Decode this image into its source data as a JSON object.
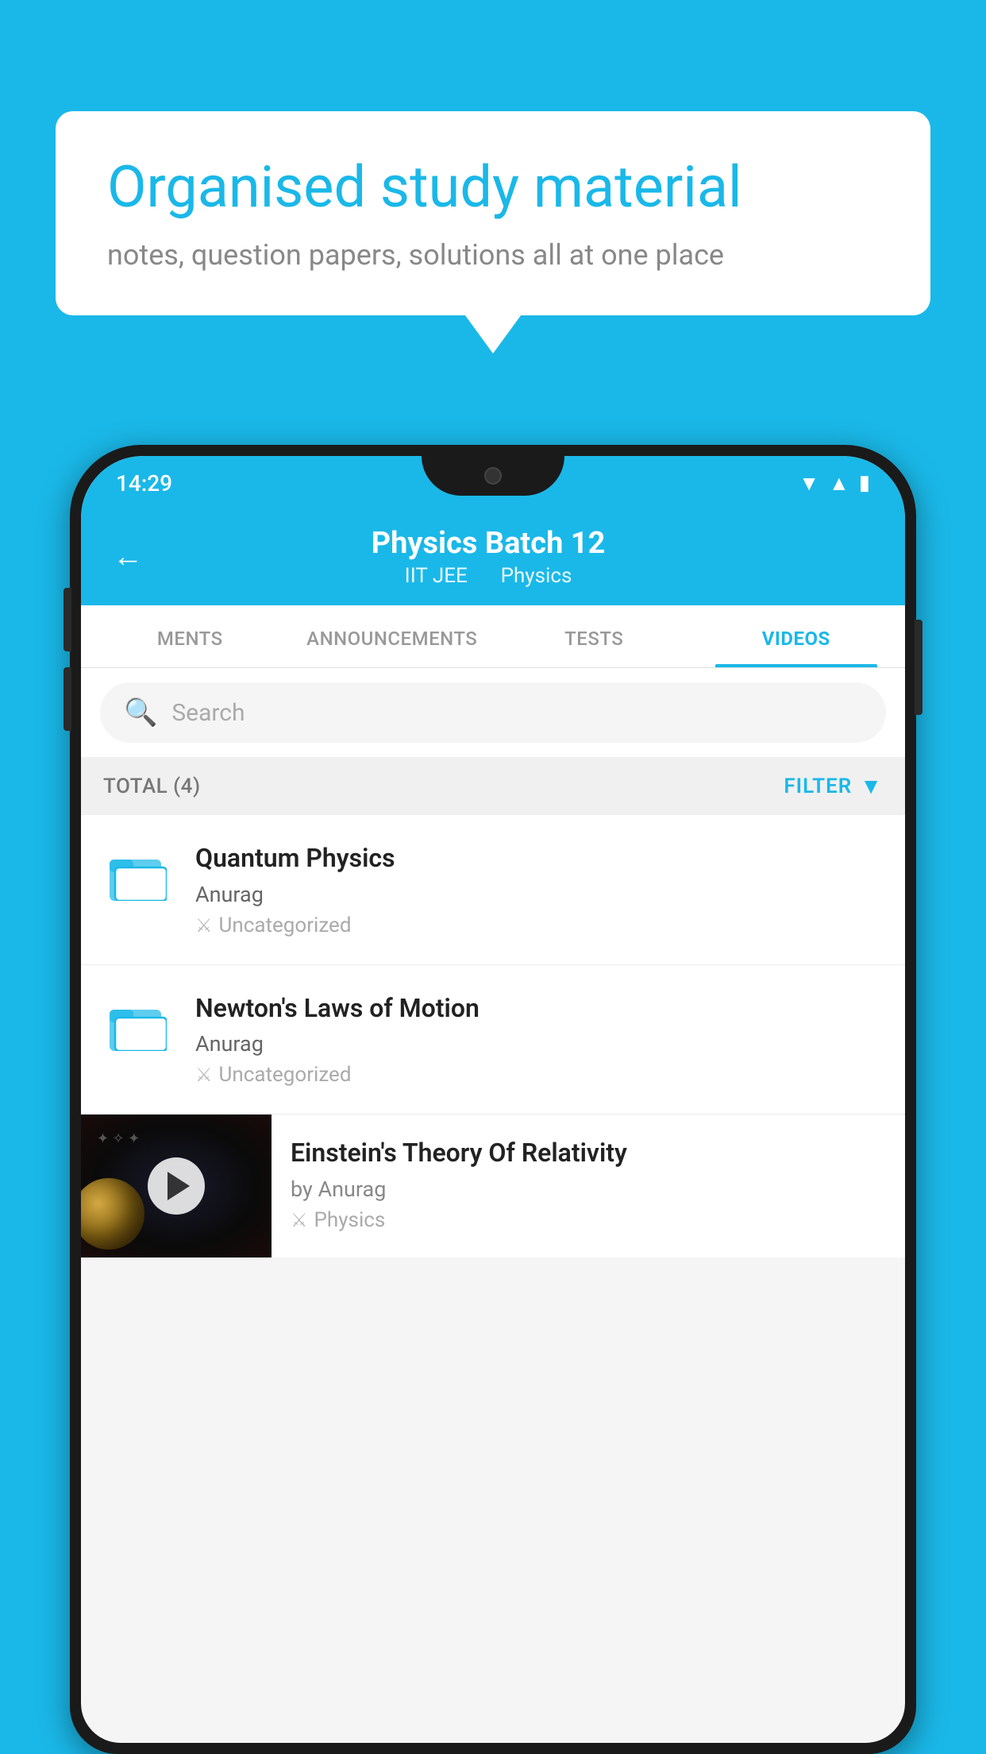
{
  "bubble": {
    "title": "Organised study material",
    "subtitle": "notes, question papers, solutions all at one place"
  },
  "statusBar": {
    "time": "14:29",
    "wifiIcon": "▲",
    "signalIcon": "▲",
    "batteryIcon": "▮"
  },
  "header": {
    "title": "Physics Batch 12",
    "subtitle1": "IIT JEE",
    "subtitle2": "Physics",
    "backLabel": "←"
  },
  "tabs": [
    {
      "label": "MENTS",
      "active": false
    },
    {
      "label": "ANNOUNCEMENTS",
      "active": false
    },
    {
      "label": "TESTS",
      "active": false
    },
    {
      "label": "VIDEOS",
      "active": true
    }
  ],
  "search": {
    "placeholder": "Search"
  },
  "filterRow": {
    "totalLabel": "TOTAL (4)",
    "filterLabel": "FILTER"
  },
  "videos": [
    {
      "title": "Quantum Physics",
      "author": "Anurag",
      "tag": "Uncategorized",
      "hasThumb": false
    },
    {
      "title": "Newton's Laws of Motion",
      "author": "Anurag",
      "tag": "Uncategorized",
      "hasThumb": false
    },
    {
      "title": "Einstein's Theory Of Relativity",
      "author": "by Anurag",
      "tag": "Physics",
      "hasThumb": true
    }
  ]
}
